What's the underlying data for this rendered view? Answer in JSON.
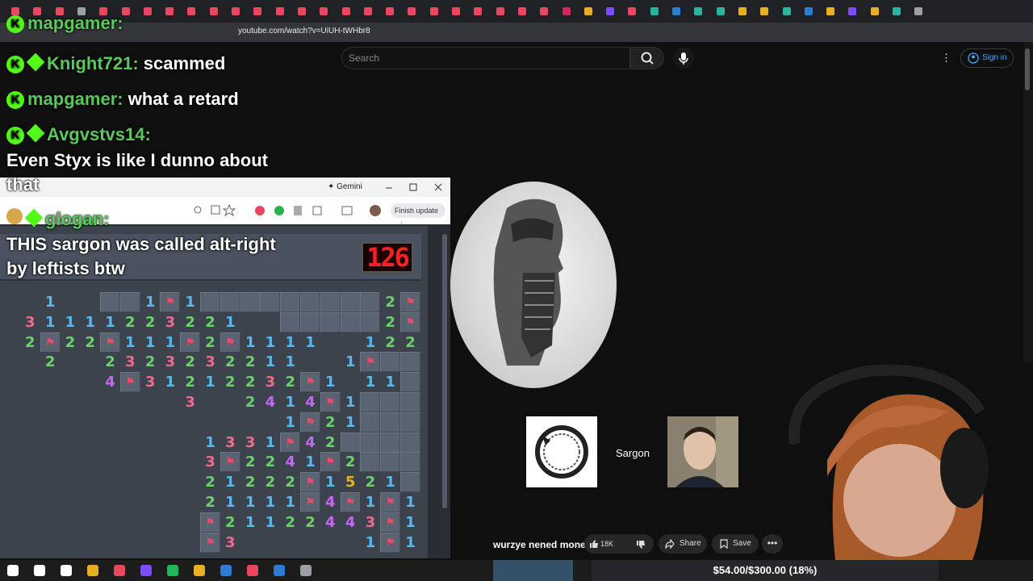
{
  "browser": {
    "url": "youtube.com/watch?v=UiUH-tWHbr8",
    "tab_colors": [
      "#e8475f",
      "#e8475f",
      "#e8475f",
      "#9aa0a6",
      "#e8475f",
      "#e8475f",
      "#e8475f",
      "#e8475f",
      "#e8475f",
      "#e8475f",
      "#e8475f",
      "#e8475f",
      "#e8475f",
      "#e8475f",
      "#e8475f",
      "#e8475f",
      "#e8475f",
      "#e8475f",
      "#e8475f",
      "#e8475f",
      "#e8475f",
      "#e8475f",
      "#e8475f",
      "#e8475f",
      "#e8475f",
      "#d1285b",
      "#e8b020",
      "#7c4dff",
      "#e8475f",
      "#2bb3a0",
      "#2b7cd3",
      "#2bb3a0",
      "#2bb3a0",
      "#e8b020",
      "#e8b020",
      "#2bb3a0",
      "#2b7cd3",
      "#e8b020",
      "#7c4dff",
      "#e8b020",
      "#2bb3a0",
      "#9aa0a6"
    ]
  },
  "youtube": {
    "search_placeholder": "Search",
    "sign_in": "Sign in",
    "video_title": "wurzye nened money",
    "like_count": "18K",
    "share": "Share",
    "save": "Save",
    "more": "•••"
  },
  "chat": [
    {
      "user": "mapgamer:",
      "message": "",
      "badges": [
        "k"
      ]
    },
    {
      "user": "Knight721:",
      "message": "scammed",
      "badges": [
        "k",
        "d"
      ]
    },
    {
      "user": "mapgamer:",
      "message": "what a retard",
      "badges": [
        "k"
      ]
    },
    {
      "user": "Avgvstvs14:",
      "message": "",
      "badges": [
        "k",
        "d"
      ]
    },
    {
      "user": "",
      "message": "Even Styx is like I dunno about"
    },
    {
      "user": "",
      "message": "that"
    },
    {
      "user": "glogan:",
      "message": "",
      "badges": [
        "y",
        "d"
      ]
    },
    {
      "user": "",
      "message": "THIS sargon was called alt-right"
    },
    {
      "user": "",
      "message": "by leftists btw"
    }
  ],
  "gemini": {
    "title": "✦ Gemini",
    "finish_update": "Finish update"
  },
  "minesweeper": {
    "timer": "126",
    "rows": [
      "..1..,,1F1,,,,,,,,,2F2",
      ".31111223221..,,,,,2F2",
      ".2F22F111F2F1111..122.",
      "..2..2323232211..1F",
      ".....4F31212232F1.11",
      ".........3..2414F1",
      "..............1F21",
      "..........1331F42",
      "..........3F2241F2",
      "..........21222F1521",
      "..........21111F4F1F1",
      "..........F21122443F1",
      "..........F3......1F1F21"
    ]
  },
  "video": {
    "guest_label": "Sargon"
  },
  "donation_goal": {
    "text": "$54.00/$300.00 (18%)",
    "progress": 0.18
  }
}
